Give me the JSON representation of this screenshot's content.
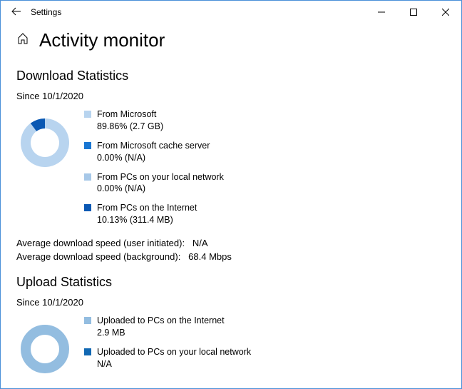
{
  "window": {
    "title": "Settings"
  },
  "page": {
    "title": "Activity monitor"
  },
  "download": {
    "heading": "Download Statistics",
    "since": "Since 10/1/2020",
    "legend": [
      {
        "label": "From Microsoft",
        "value": "89.86%  (2.7 GB)",
        "color": "#b8d4ef"
      },
      {
        "label": "From Microsoft cache server",
        "value": "0.00%  (N/A)",
        "color": "#1976d2"
      },
      {
        "label": "From PCs on your local network",
        "value": "0.00%  (N/A)",
        "color": "#a7c8e8"
      },
      {
        "label": "From PCs on the Internet",
        "value": "10.13%  (311.4 MB)",
        "color": "#0a58b3"
      }
    ],
    "avg_user_label": "Average download speed (user initiated):",
    "avg_user_value": "N/A",
    "avg_bg_label": "Average download speed (background):",
    "avg_bg_value": "68.4 Mbps"
  },
  "upload": {
    "heading": "Upload Statistics",
    "since": "Since 10/1/2020",
    "legend": [
      {
        "label": "Uploaded to PCs on the Internet",
        "value": "2.9 MB",
        "color": "#93bde0"
      },
      {
        "label": "Uploaded to PCs on your local network",
        "value": "N/A",
        "color": "#1168b3"
      }
    ]
  },
  "chart_data": [
    {
      "type": "pie",
      "title": "Download sources",
      "series": [
        {
          "name": "From Microsoft",
          "value": 89.86,
          "color": "#b8d4ef"
        },
        {
          "name": "From Microsoft cache server",
          "value": 0.0,
          "color": "#1976d2"
        },
        {
          "name": "From PCs on your local network",
          "value": 0.0,
          "color": "#a7c8e8"
        },
        {
          "name": "From PCs on the Internet",
          "value": 10.13,
          "color": "#0a58b3"
        }
      ]
    },
    {
      "type": "pie",
      "title": "Upload destinations",
      "series": [
        {
          "name": "Uploaded to PCs on the Internet",
          "value": 100,
          "color": "#93bde0"
        },
        {
          "name": "Uploaded to PCs on your local network",
          "value": 0,
          "color": "#1168b3"
        }
      ]
    }
  ]
}
